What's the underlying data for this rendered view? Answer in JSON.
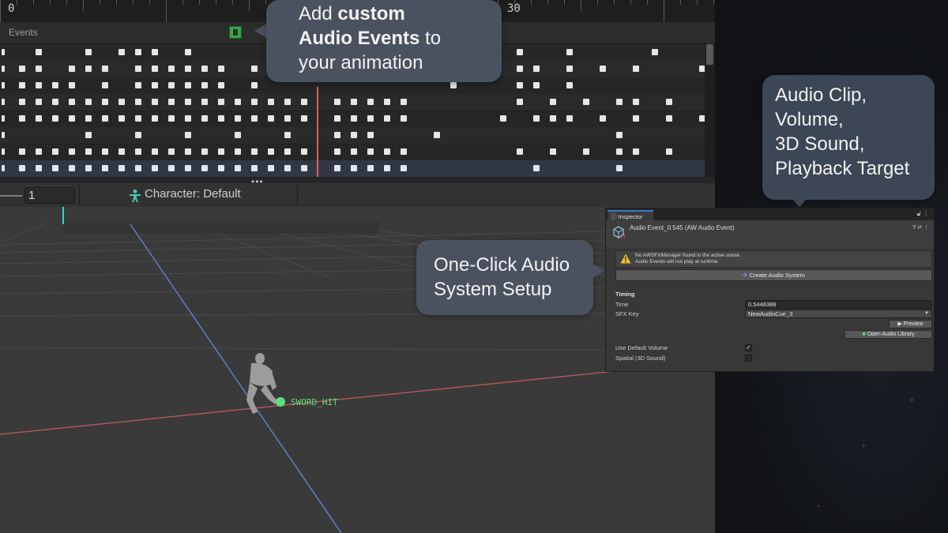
{
  "timeline": {
    "ruler_start": "0",
    "ruler_mark": "30",
    "events_label": "Events",
    "overflow_dots": "•••"
  },
  "preview_toolbar": {
    "frame_value": "1",
    "character_label": "Character: Default"
  },
  "scene": {
    "event_label": "SWORD_HIT"
  },
  "callouts": {
    "events": {
      "line1": "Add ",
      "line1_bold": "custom",
      "line2_bold": "Audio Events",
      "line2_rest": " to",
      "line3": "your animation"
    },
    "clip": {
      "line1": "Audio Clip,",
      "line2": "Volume,",
      "line3": "3D Sound,",
      "line4": "Playback Target"
    },
    "setup": {
      "line1": "One-Click Audio",
      "line2": "System Setup"
    }
  },
  "inspector": {
    "tab_label": "Inspector",
    "asset_title": "Audio Event_0.545 (AW Audio Event)",
    "warning_line1": "No AWSFXManager found in the active scene.",
    "warning_line2": "Audio Events will not play at runtime.",
    "create_button": "Create Audio System",
    "section_timing": "Timing",
    "time_label": "Time",
    "time_value": "0.5448388",
    "sfx_key_label": "SFX Key",
    "sfx_key_value": "NewAudioCue_3",
    "preview_button": "Preview",
    "open_library_button": "Open Audio Library",
    "use_default_volume_label": "Use Default Volume",
    "use_default_volume_checked": true,
    "spatial_label": "Spatial (3D Sound)",
    "spatial_checked": false
  },
  "colors": {
    "accent_blue": "#3c79c8",
    "event_green": "#5ce07d",
    "playhead_red": "#e06050",
    "callout_bg": "#4a5260"
  },
  "icons": [
    "sound-event-icon",
    "humanoid-icon",
    "warning-icon",
    "asset-cube-icon",
    "lock-icon",
    "menu-icon",
    "help-icon",
    "settings-icon",
    "play-icon",
    "library-icon"
  ]
}
